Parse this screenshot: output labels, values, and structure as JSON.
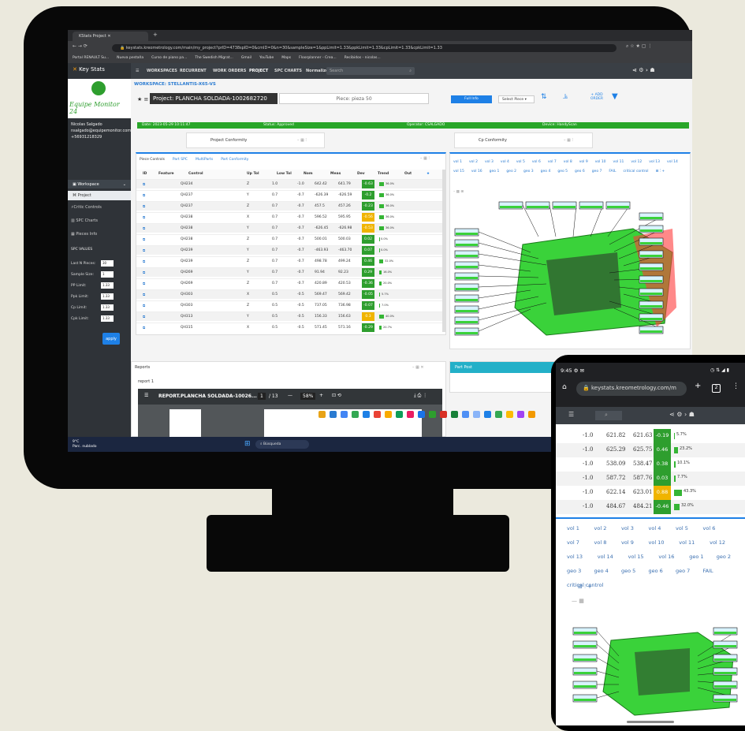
{
  "browser": {
    "tab_title": "KStats Project",
    "url": "keystats.kreometrology.com/main/my_project?prID=4738spID=0&cmID=0&n=30&sampleSize=1&ppLimit=1.33&ppkLimit=1.33&cpLimit=1.33&cpkLimit=1.33",
    "bookmarks": [
      "Portal RENAULT Su...",
      "Nueva pestaña",
      "Curso de piano pa...",
      "The Swedish Migrat...",
      "Gmail",
      "YouTube",
      "Maps",
      "Floorplanner - Crea...",
      "Recibidos - nicolas..."
    ]
  },
  "app": {
    "logo_text": "Key Stats",
    "brand_text": "Equipe Monitor 24",
    "user_name": "Nicolas Salgado",
    "user_email": "nsalgado@equipemonitor.com",
    "user_phone": "+56931218329",
    "sidebar": {
      "section": "Workspace",
      "items": [
        "Project",
        "Critic Controls",
        "SPC Charts",
        "Pieces Info"
      ],
      "spc_values_title": "SPC VALUES",
      "fields": [
        {
          "label": "Last N Pieces:",
          "value": "30"
        },
        {
          "label": "Sample Size:",
          "value": "1"
        },
        {
          "label": "PP Limit:",
          "value": "1.33"
        },
        {
          "label": "Ppk Limit:",
          "value": "1.33"
        },
        {
          "label": "Cp Limit:",
          "value": "1.33"
        },
        {
          "label": "Cpk Limit:",
          "value": "1.33"
        }
      ],
      "apply_label": "apply"
    },
    "topnav": [
      "WORKSPACES",
      "RECURRENT",
      "WORK ORDERS",
      "PROJECT",
      "SPC CHARTS",
      "Normalized R CHART"
    ],
    "search_placeholder": "Search",
    "workspace_label": "WORKSPACE: STELLANTIS-X65-VS",
    "project_label": "Project: PLANCHA SOLDADA-1002682720",
    "piece_label": "Piece: pieza 50",
    "full_info_label": "Full Info",
    "select_piece_label": "Select Piece",
    "add_order_label": "+ ADD ORDER",
    "status_bar": {
      "date": "Date: 2023-05-29 10:11:47",
      "status": "Status: Approved",
      "operator": "Operator: CSALGADO",
      "device": "Device: HandyScan"
    },
    "project_conformity": "Project Conformity",
    "cp_conformity": "Cp Conformity",
    "table_tabs": [
      "Piece Controls",
      "Part SPC",
      "MultiParts",
      "Part Conformity"
    ],
    "table_headers": [
      "ID",
      "Feature",
      "Control",
      "Up Tol",
      "Low Tol",
      "Nom",
      "Meas",
      "Dev",
      "Trend",
      "Out"
    ],
    "rows": [
      {
        "feature": "QH234",
        "control": "Z",
        "up": "1.0",
        "low": "-1.0",
        "nom": "642.42",
        "meas": "641.79",
        "dev": "-0.63",
        "dev_color": "#2e9e2e",
        "trend": "36.0%",
        "trend_level": 0.36
      },
      {
        "feature": "QH237",
        "control": "Y",
        "up": "0.7",
        "low": "-0.7",
        "nom": "-626.39",
        "meas": "-626.59",
        "dev": "-0.2",
        "dev_color": "#2e9e2e",
        "trend": "36.0%",
        "trend_level": 0.36
      },
      {
        "feature": "QH237",
        "control": "Z",
        "up": "0.7",
        "low": "-0.7",
        "nom": "457.5",
        "meas": "457.26",
        "dev": "-0.23",
        "dev_color": "#2e9e2e",
        "trend": "36.0%",
        "trend_level": 0.36
      },
      {
        "feature": "QH238",
        "control": "X",
        "up": "0.7",
        "low": "-0.7",
        "nom": "596.52",
        "meas": "595.95",
        "dev": "-0.56",
        "dev_color": "#f0b400",
        "trend": "36.0%",
        "trend_level": 0.36
      },
      {
        "feature": "QH238",
        "control": "Y",
        "up": "0.7",
        "low": "-0.7",
        "nom": "-626.45",
        "meas": "-626.98",
        "dev": "-0.53",
        "dev_color": "#f0b400",
        "trend": "36.0%",
        "trend_level": 0.36
      },
      {
        "feature": "QH238",
        "control": "Z",
        "up": "0.7",
        "low": "-0.7",
        "nom": "500.01",
        "meas": "500.03",
        "dev": "0.02",
        "dev_color": "#2e9e2e",
        "trend": "0.0%",
        "trend_level": 0.0
      },
      {
        "feature": "QH239",
        "control": "Y",
        "up": "0.7",
        "low": "-0.7",
        "nom": "-463.93",
        "meas": "-463.70",
        "dev": "0.07",
        "dev_color": "#2e9e2e",
        "trend": "0.0%",
        "trend_level": 0.0
      },
      {
        "feature": "QH239",
        "control": "Z",
        "up": "0.7",
        "low": "-0.7",
        "nom": "498.78",
        "meas": "499.24",
        "dev": "0.46",
        "dev_color": "#2e9e2e",
        "trend": "32.0%",
        "trend_level": 0.32
      },
      {
        "feature": "QH269",
        "control": "Y",
        "up": "0.7",
        "low": "-0.7",
        "nom": "91.94",
        "meas": "92.23",
        "dev": "0.29",
        "dev_color": "#2e9e2e",
        "trend": "16.0%",
        "trend_level": 0.16
      },
      {
        "feature": "QH269",
        "control": "Z",
        "up": "0.7",
        "low": "-0.7",
        "nom": "420.89",
        "meas": "420.53",
        "dev": "-0.36",
        "dev_color": "#2e9e2e",
        "trend": "20.0%",
        "trend_level": 0.2
      },
      {
        "feature": "QH303",
        "control": "X",
        "up": "0.5",
        "low": "-0.5",
        "nom": "569.47",
        "meas": "569.42",
        "dev": "-0.05",
        "dev_color": "#2e9e2e",
        "trend": "5.7%",
        "trend_level": 0.057
      },
      {
        "feature": "QH303",
        "control": "Z",
        "up": "0.5",
        "low": "-0.5",
        "nom": "737.05",
        "meas": "736.98",
        "dev": "-0.07",
        "dev_color": "#2e9e2e",
        "trend": "7.0%",
        "trend_level": 0.07
      },
      {
        "feature": "QH313",
        "control": "Y",
        "up": "0.5",
        "low": "-0.5",
        "nom": "156.33",
        "meas": "156.63",
        "dev": "0.3",
        "dev_color": "#f0b400",
        "trend": "40.0%",
        "trend_level": 0.4
      },
      {
        "feature": "QH315",
        "control": "X",
        "up": "0.5",
        "low": "-0.5",
        "nom": "571.45",
        "meas": "571.16",
        "dev": "-0.29",
        "dev_color": "#2e9e2e",
        "trend": "20.7%",
        "trend_level": 0.207
      }
    ],
    "vol_tabs": [
      "vol 1",
      "vol 2",
      "vol 3",
      "vol 4",
      "vol 5",
      "vol 6",
      "vol 7",
      "vol 8",
      "vol 9",
      "vol 10",
      "vol 11",
      "vol 12",
      "vol 13",
      "vol 14",
      "vol 15",
      "vol 16",
      "geo 1",
      "geo 2",
      "geo 3",
      "geo 4",
      "geo 5",
      "geo 6",
      "geo 7",
      "FAIL",
      "critical control"
    ],
    "reports_title": "Reports",
    "report_item": "report 1",
    "pdf_title": "REPORT.PLANCHA SOLDADA-10026...",
    "pdf_page": "1",
    "pdf_pages": "/ 13",
    "pdf_zoom": "58%",
    "part_post_title": "Part Post",
    "taskbar_search": "Búsqueda",
    "weather_temp": "9°C",
    "weather_text": "Parc. nublado"
  },
  "phone": {
    "time": "9:45",
    "url": "keystats.kreometrology.com/m",
    "tab_count": "2",
    "rows": [
      {
        "low": "-1.0",
        "nom": "621.82",
        "meas": "621.63",
        "dev": "-0.19",
        "dev_color": "#2e9e2e",
        "trend": "5.7%",
        "trend_level": 0.057
      },
      {
        "low": "-1.0",
        "nom": "625.29",
        "meas": "625.75",
        "dev": "0.46",
        "dev_color": "#2e9e2e",
        "trend": "23.2%",
        "trend_level": 0.232
      },
      {
        "low": "-1.0",
        "nom": "538.09",
        "meas": "538.47",
        "dev": "0.38",
        "dev_color": "#2e9e2e",
        "trend": "10.1%",
        "trend_level": 0.101
      },
      {
        "low": "-1.0",
        "nom": "587.72",
        "meas": "587.76",
        "dev": "0.03",
        "dev_color": "#2e9e2e",
        "trend": "7.7%",
        "trend_level": 0.077
      },
      {
        "low": "-1.0",
        "nom": "622.14",
        "meas": "623.01",
        "dev": "0.88",
        "dev_color": "#f0b400",
        "trend": "43.3%",
        "trend_level": 0.433
      },
      {
        "low": "-1.0",
        "nom": "484.67",
        "meas": "484.21",
        "dev": "-0.46",
        "dev_color": "#2e9e2e",
        "trend": "32.0%",
        "trend_level": 0.32
      }
    ],
    "tabs": [
      "vol 1",
      "vol 2",
      "vol 3",
      "vol 4",
      "vol 5",
      "vol 6",
      "vol 7",
      "vol 8",
      "vol 9",
      "vol 10",
      "vol 11",
      "vol 12",
      "vol 13",
      "vol 14",
      "vol 15",
      "vol 16",
      "geo 1",
      "geo 2",
      "geo 3",
      "geo 4",
      "geo 5",
      "geo 6",
      "geo 7",
      "FAIL",
      "critical control"
    ]
  }
}
